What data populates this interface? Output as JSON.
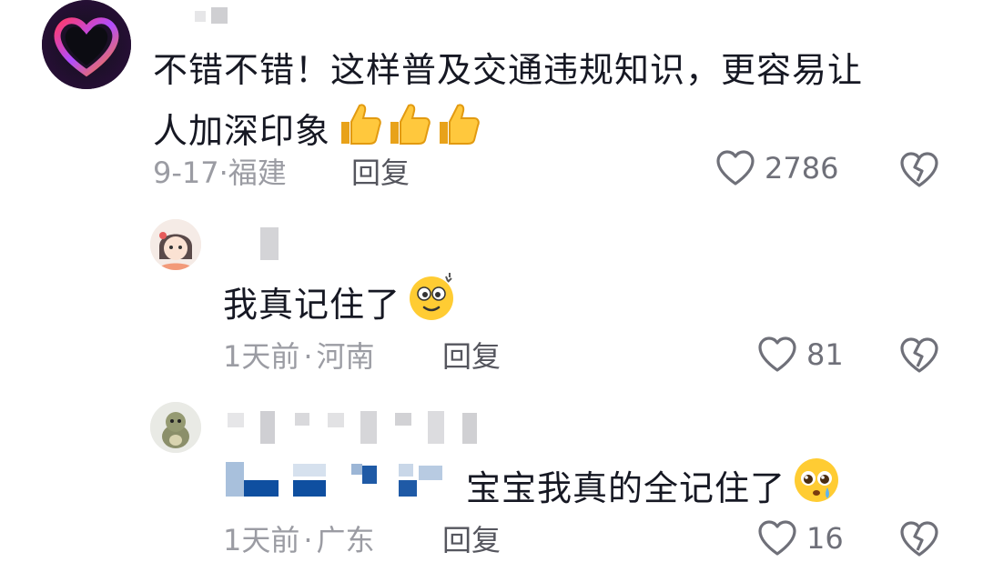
{
  "comments": [
    {
      "username": "",
      "text": "不错不错！这样普及交通违规知识，更容易让",
      "text_line2": "人加深印象",
      "emojis": [
        "thumbs-up",
        "thumbs-up",
        "thumbs-up"
      ],
      "date": "9-17",
      "location": "福建",
      "reply_label": "回复",
      "likes": "2786"
    },
    {
      "username": "",
      "text": "我真记住了",
      "emojis": [
        "dizzy-face"
      ],
      "date": "1天前",
      "location": "河南",
      "reply_label": "回复",
      "likes": "81"
    },
    {
      "username": "",
      "text": "宝宝我真的全记住了",
      "emojis": [
        "pleading-face"
      ],
      "date": "1天前",
      "location": "广东",
      "reply_label": "回复",
      "likes": "16"
    }
  ],
  "separator": "·",
  "colors": {
    "text": "#161823",
    "meta": "#9b9ca3",
    "reply": "#55565e",
    "mention_blue": "#0f4fa0"
  }
}
